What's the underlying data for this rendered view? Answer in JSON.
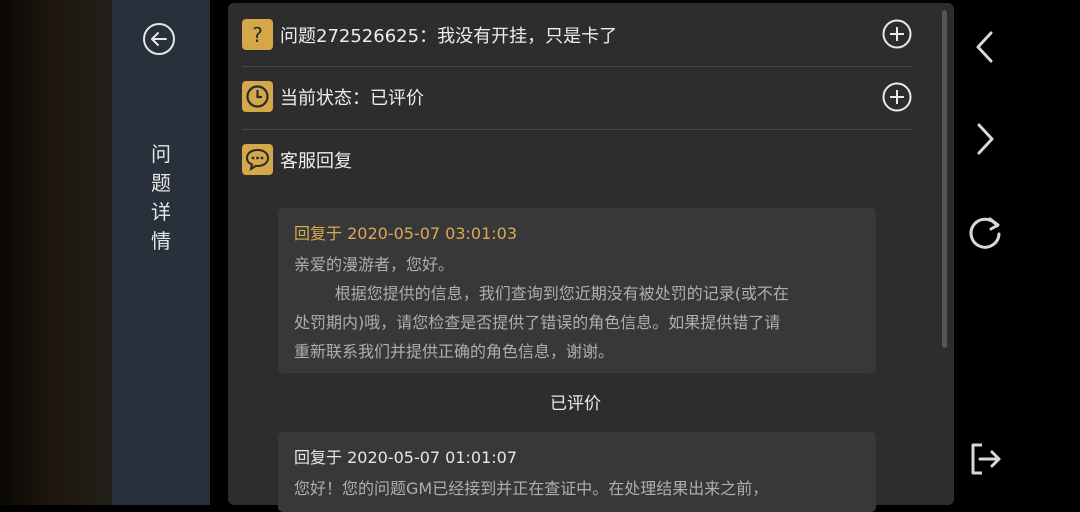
{
  "sidebar": {
    "title_chars": [
      "问",
      "题",
      "详",
      "情"
    ]
  },
  "header": {
    "question_label": "问题272526625：我没有开挂，只是卡了",
    "status_label": "当前状态：已评价",
    "reply_section_label": "客服回复"
  },
  "replies": [
    {
      "time_label": "回复于 2020-05-07 03:01:03",
      "lines": [
        "亲爱的漫游者，您好。",
        "        根据您提供的信息，我们查询到您近期没有被处罚的记录(或不在",
        "处罚期内)哦，请您检查是否提供了错误的角色信息。如果提供错了请",
        "重新联系我们并提供正确的角色信息，谢谢。"
      ]
    },
    {
      "time_label": "回复于 2020-05-07 01:01:07",
      "lines": [
        "您好！您的问题GM已经接到并正在查证中。在处理结果出来之前，"
      ]
    }
  ],
  "rated_label": "已评价",
  "colors": {
    "accent_gold": "#d4a849",
    "panel_bg": "#2d2d2f",
    "sidebar_bg": "#27303b"
  },
  "icons": {
    "back": "circle-arrow-left-icon",
    "question": "question-mark-icon",
    "clock": "clock-icon",
    "chat": "chat-bubble-icon",
    "expand": "plus-circle-icon",
    "nav_prev": "chevron-left-icon",
    "nav_next": "chevron-right-icon",
    "refresh": "refresh-icon",
    "exit": "exit-icon"
  }
}
